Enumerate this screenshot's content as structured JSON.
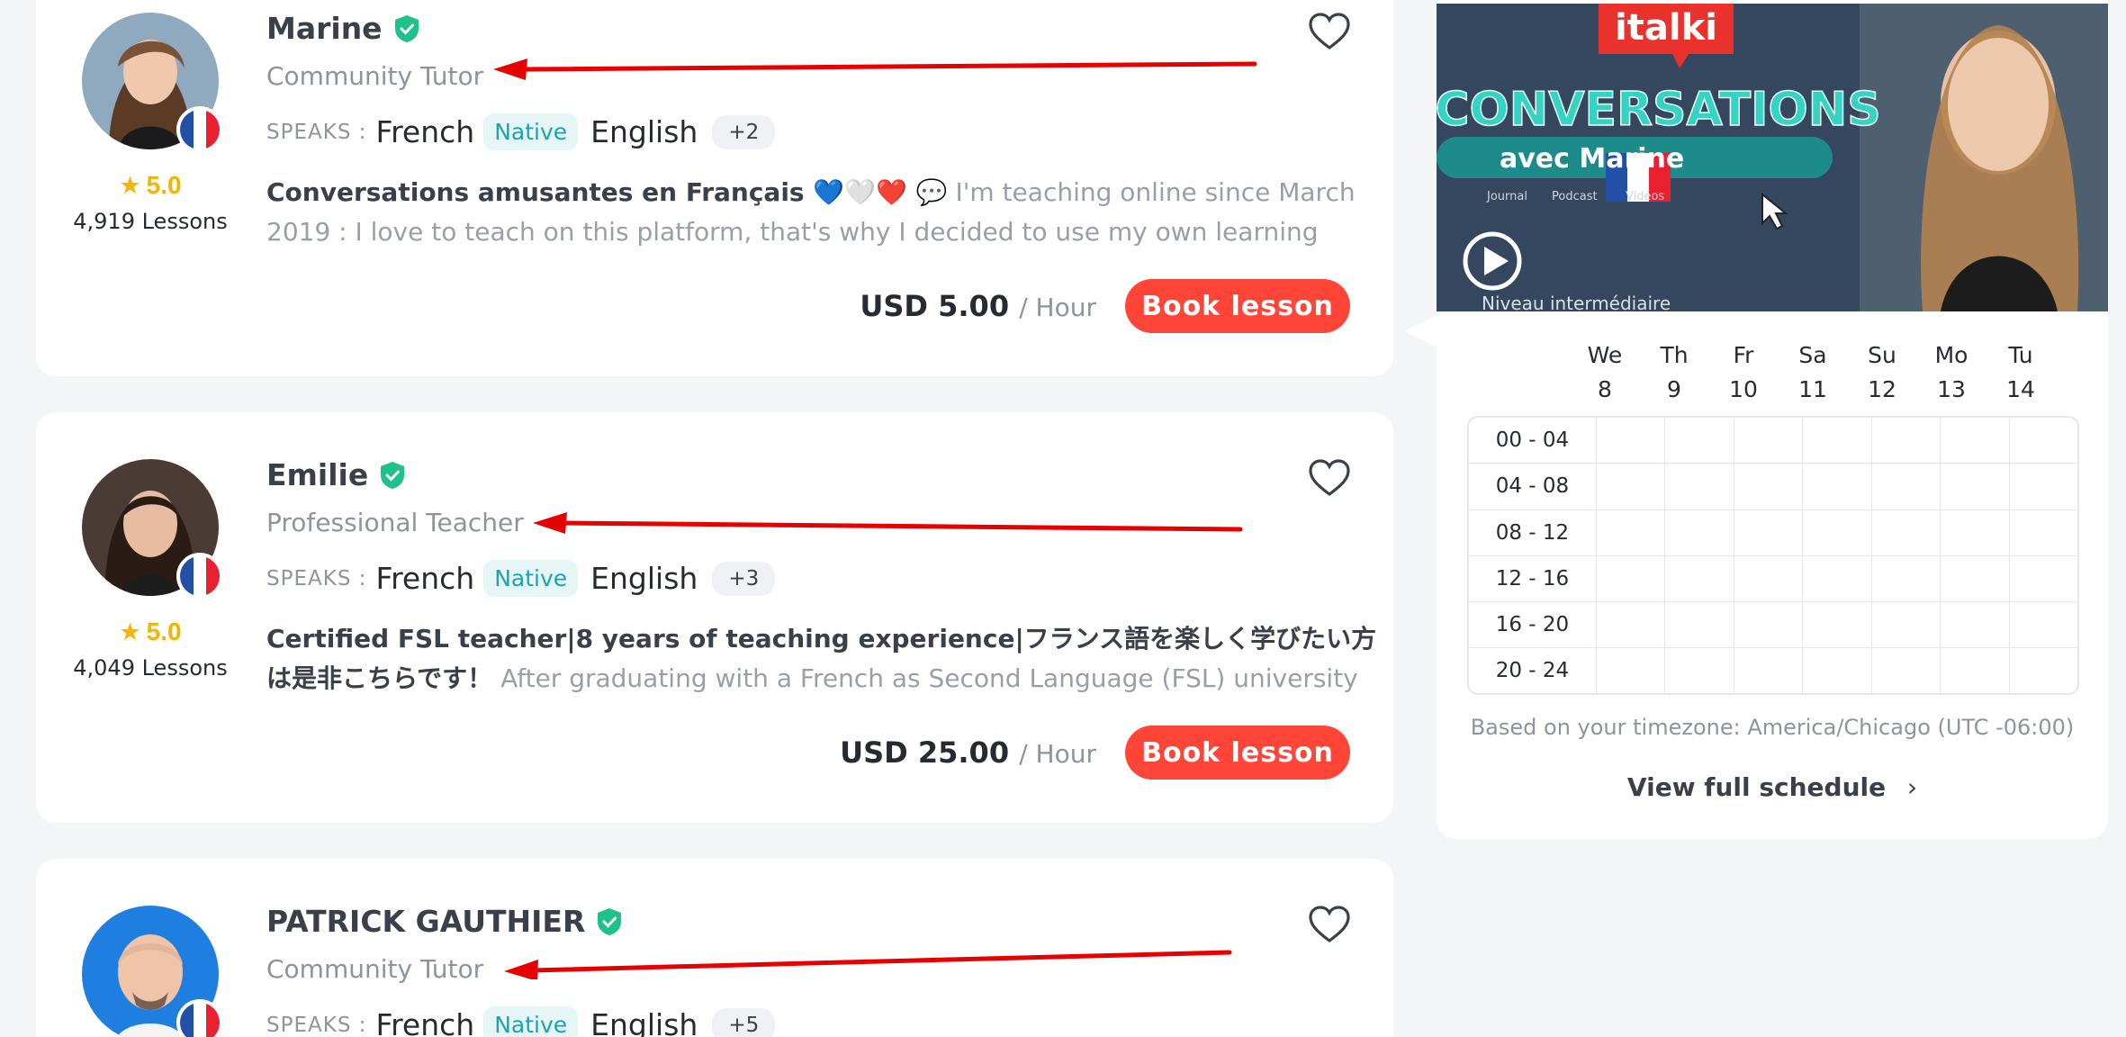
{
  "tutors": [
    {
      "name": "Marine",
      "role": "Community Tutor",
      "speaks_label": "SPEAKS :",
      "lang1": "French",
      "native_badge": "Native",
      "lang2": "English",
      "more_langs": "+2",
      "rating": "5.0",
      "lessons": "4,919 Lessons",
      "headline": "Conversations amusantes en Français 💙🤍❤️ 💬",
      "about": " I'm teaching online since March 2019 : I love to teach on this platform, that's why I decided to use my own learning journey and...",
      "price": "USD 5.00",
      "per": "/ Hour",
      "book": "Book lesson"
    },
    {
      "name": "Emilie",
      "role": "Professional Teacher",
      "speaks_label": "SPEAKS :",
      "lang1": "French",
      "native_badge": "Native",
      "lang2": "English",
      "more_langs": "+3",
      "rating": "5.0",
      "lessons": "4,049 Lessons",
      "headline": "Certified FSL teacher|8 years of teaching experience|フランス語を楽しく学びたい方は是非こちらです！",
      "about": " After graduating with a French as Second Language (FSL) university degree, I...",
      "price": "USD 25.00",
      "per": "/ Hour",
      "book": "Book lesson"
    },
    {
      "name": "PATRICK GAUTHIER",
      "role": "Community Tutor",
      "speaks_label": "SPEAKS :",
      "lang1": "French",
      "native_badge": "Native",
      "lang2": "English",
      "more_langs": "+5"
    }
  ],
  "video": {
    "brand": "italki",
    "title": "CONVERSATIONS",
    "subtitle": "avec Marine",
    "tags": [
      "Journal",
      "Podcast",
      "Vidéos"
    ],
    "level": "Niveau intermédiaire"
  },
  "schedule": {
    "days": [
      {
        "d": "We",
        "n": "8"
      },
      {
        "d": "Th",
        "n": "9"
      },
      {
        "d": "Fr",
        "n": "10"
      },
      {
        "d": "Sa",
        "n": "11"
      },
      {
        "d": "Su",
        "n": "12"
      },
      {
        "d": "Mo",
        "n": "13"
      },
      {
        "d": "Tu",
        "n": "14"
      }
    ],
    "slots": [
      "00 - 04",
      "04 - 08",
      "08 - 12",
      "12 - 16",
      "16 - 20",
      "20 - 24"
    ],
    "timezone": "Based on your timezone: America/Chicago (UTC -06:00)",
    "full_link": "View full schedule"
  },
  "colors": {
    "accent": "#ff4438",
    "verified": "#21c18b",
    "arrow": "#e60000",
    "star": "#f4b400"
  }
}
